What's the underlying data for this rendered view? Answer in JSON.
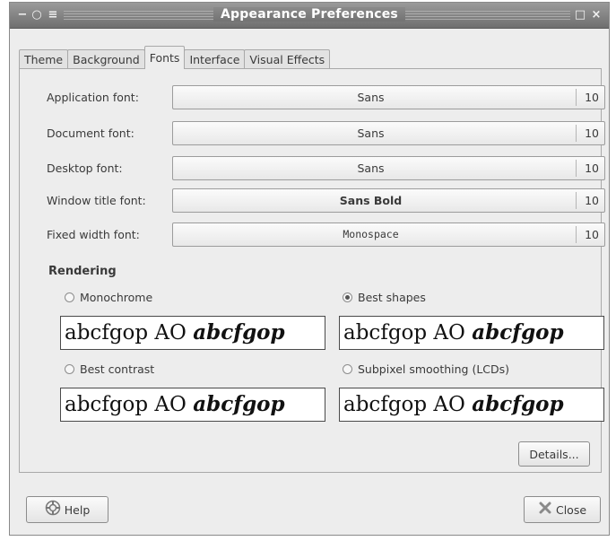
{
  "window": {
    "title": "Appearance Preferences",
    "controls": {
      "menu_icon": "−",
      "sticky_icon": "○",
      "shade_icon": "≡",
      "maximize_icon": "□",
      "close_icon": "×"
    }
  },
  "tabs": [
    {
      "label": "Theme",
      "active": false
    },
    {
      "label": "Background",
      "active": false
    },
    {
      "label": "Fonts",
      "active": true
    },
    {
      "label": "Interface",
      "active": false
    },
    {
      "label": "Visual Effects",
      "active": false
    }
  ],
  "fonts": [
    {
      "label": "Application font:",
      "font": "Sans",
      "size": "10"
    },
    {
      "label": "Document font:",
      "font": "Sans",
      "size": "10"
    },
    {
      "label": "Desktop font:",
      "font": "Sans",
      "size": "10"
    },
    {
      "label": "Window title font:",
      "font": "Sans Bold",
      "size": "10"
    },
    {
      "label": "Fixed width font:",
      "font": "Monospace",
      "size": "10"
    }
  ],
  "rendering": {
    "title": "Rendering",
    "sample_regular": "abcfgop AO ",
    "sample_italic": "abcfgop",
    "options": [
      {
        "label": "Monochrome",
        "selected": false
      },
      {
        "label": "Best shapes",
        "selected": true
      },
      {
        "label": "Best contrast",
        "selected": false
      },
      {
        "label": "Subpixel smoothing (LCDs)",
        "selected": false
      }
    ]
  },
  "buttons": {
    "details": "Details...",
    "help": "Help",
    "close": "Close"
  }
}
